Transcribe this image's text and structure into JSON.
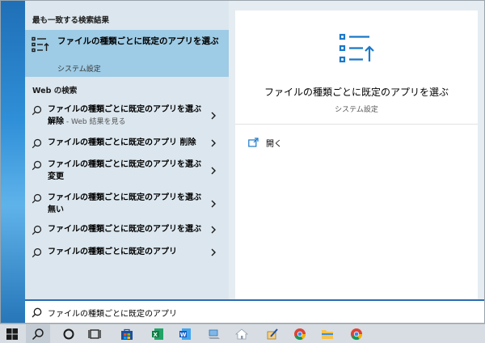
{
  "search_panel": {
    "best_match_header": "最も一致する検索結果",
    "best_match": {
      "title": "ファイルの種類ごとに既定のアプリを選ぶ",
      "subtitle": "システム設定",
      "icon": "default-apps-icon"
    },
    "web_header": "Web の検索",
    "web_results": [
      {
        "bold_part": "ファイルの種類ごとに既定のアプリを選ぶ",
        "second_line": "解除",
        "note": " - Web 結果を見る"
      },
      {
        "bold_part": "ファイルの種類ごとに既定のアプリ 削除",
        "second_line": "",
        "note": ""
      },
      {
        "bold_part": "ファイルの種類ごとに既定のアプリを選ぶ",
        "second_line": "変更",
        "note": ""
      },
      {
        "bold_part": "ファイルの種類ごとに既定のアプリを選ぶ",
        "second_line": "無い",
        "note": ""
      },
      {
        "bold_part": "ファイルの種類ごとに既定のアプリを選ぶ",
        "second_line": "",
        "note": ""
      },
      {
        "bold_part": "ファイルの種類ごとに既定のアプリ",
        "second_line": "",
        "note": ""
      }
    ]
  },
  "detail": {
    "title": "ファイルの種類ごとに既定のアプリを選ぶ",
    "subtitle": "システム設定",
    "actions": [
      {
        "label": "開く",
        "icon": "open-icon"
      }
    ]
  },
  "search_box": {
    "value": "ファイルの種類ごとに既定のアプリ",
    "icon": "search-icon"
  },
  "taskbar": {
    "items": [
      "start-icon",
      "search-icon",
      "cortana-icon",
      "task-view-icon",
      "store-icon",
      "excel-icon",
      "word-icon",
      "pc-icon",
      "home-icon",
      "paint-icon",
      "chrome-icon",
      "file-explorer-icon",
      "chrome-icon"
    ]
  },
  "colors": {
    "accent": "#2b6cb3",
    "selected_row": "#9ecbe5",
    "left_pane": "#dbe6ee",
    "icon_blue": "#1b78c8"
  }
}
